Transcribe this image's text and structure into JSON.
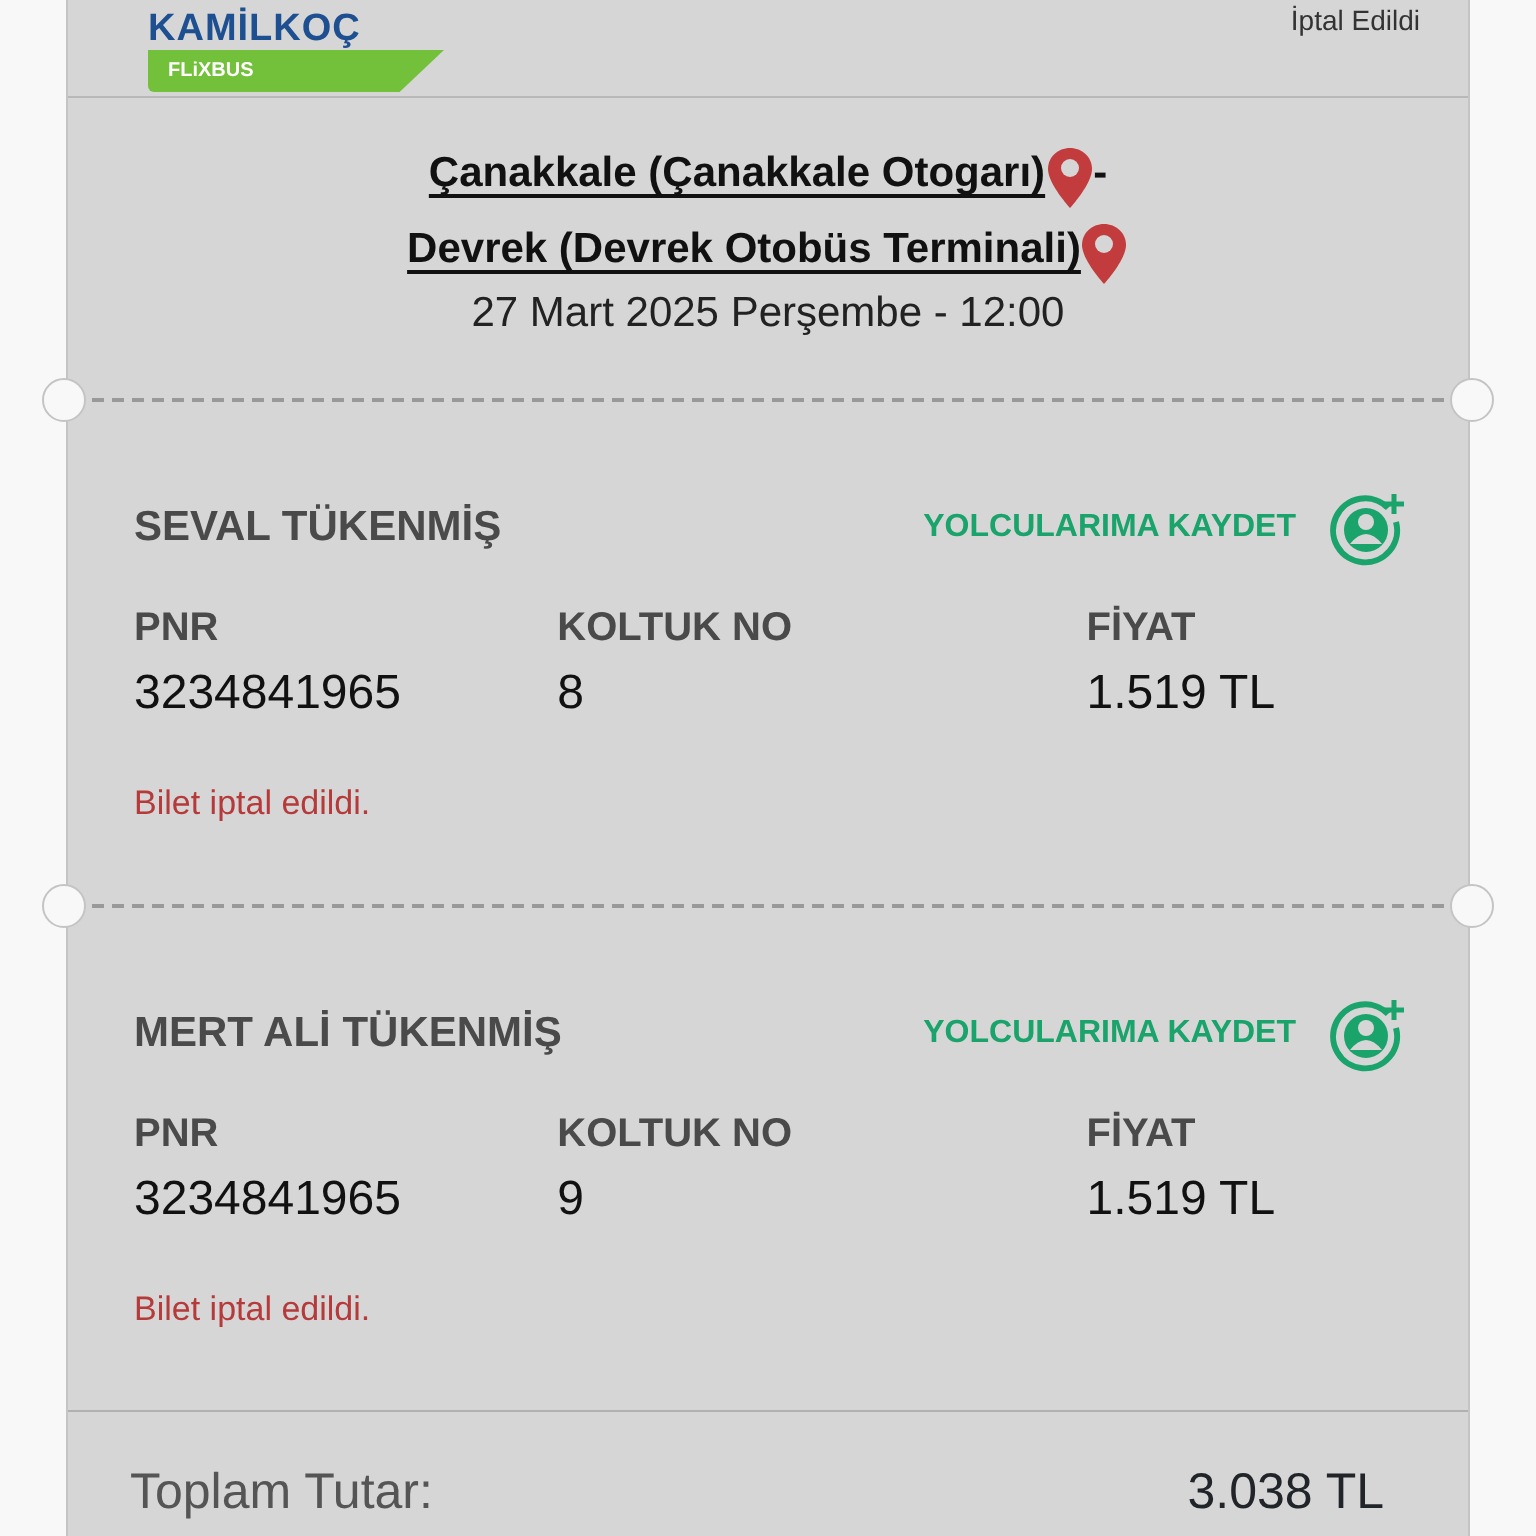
{
  "header": {
    "brand": "KAMİLKOÇ",
    "sub_brand": "FLiXBUS",
    "status": "İptal Edildi"
  },
  "trip": {
    "origin": "Çanakkale (Çanakkale Otogarı)",
    "separator": "-",
    "destination": "Devrek (Devrek Otobüs Terminali)",
    "date": "27 Mart 2025 Perşembe - 12:00"
  },
  "passengers": [
    {
      "name": "SEVAL TÜKENMİŞ",
      "save_label": "YOLCULARIMA KAYDET",
      "fields": [
        {
          "label": "PNR",
          "value": "3234841965"
        },
        {
          "label": "KOLTUK NO",
          "value": "8"
        },
        {
          "label": "FİYAT",
          "value": "1.519 TL"
        }
      ],
      "note": "Bilet iptal edildi."
    },
    {
      "name": "MERT ALİ TÜKENMİŞ",
      "save_label": "YOLCULARIMA KAYDET",
      "fields": [
        {
          "label": "PNR",
          "value": "3234841965"
        },
        {
          "label": "KOLTUK NO",
          "value": "9"
        },
        {
          "label": "FİYAT",
          "value": "1.519 TL"
        }
      ],
      "note": "Bilet iptal edildi."
    }
  ],
  "total": {
    "label": "Toplam Tutar:",
    "value": "3.038 TL"
  }
}
